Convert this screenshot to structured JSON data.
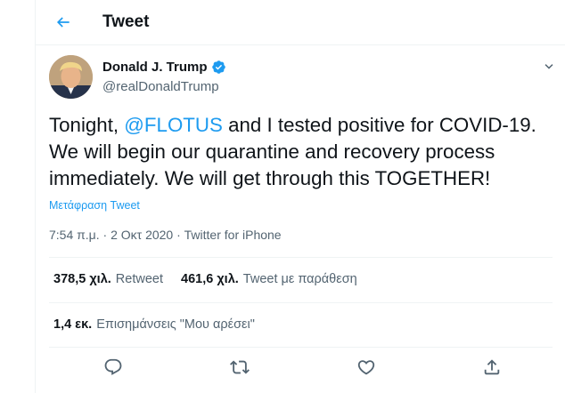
{
  "header": {
    "title": "Tweet"
  },
  "author": {
    "name": "Donald J. Trump",
    "handle": "@realDonaldTrump",
    "verified": true
  },
  "tweet": {
    "text_before": "Tonight, ",
    "mention": "@FLOTUS",
    "text_after": " and I tested positive for COVID-19. We will begin our quarantine and recovery process immediately. We will get through this TOGETHER!",
    "translate_label": "Μετάφραση Tweet",
    "time": "7:54 π.μ. · 2 Οκτ 2020 · ",
    "source": "Twitter for iPhone"
  },
  "stats": {
    "retweets_count": "378,5 χιλ.",
    "retweets_label": "Retweet",
    "quotes_count": "461,6 χιλ.",
    "quotes_label": "Tweet με παράθεση",
    "likes_count": "1,4 εκ.",
    "likes_label": "Επισημάνσεις \"Μου αρέσει\""
  },
  "colors": {
    "accent": "#1d9bf0",
    "muted": "#536471",
    "text": "#0f1419",
    "divider": "#eff3f4"
  },
  "icons": {
    "back": "arrow-left-icon",
    "verified": "verified-badge-icon",
    "more": "chevron-down-icon",
    "reply": "reply-icon",
    "retweet": "retweet-icon",
    "like": "heart-icon",
    "share": "share-icon"
  }
}
